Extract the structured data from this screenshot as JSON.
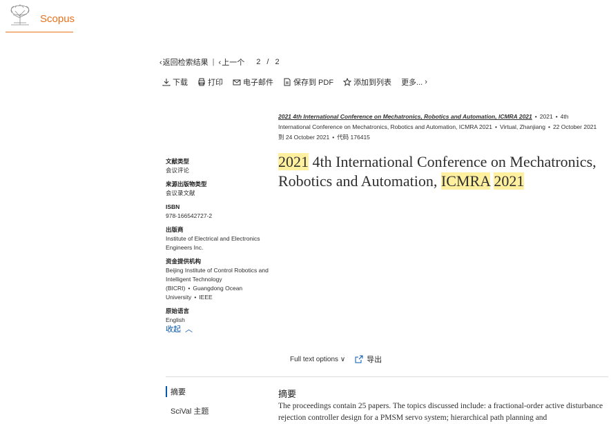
{
  "brand": {
    "name": "Scopus",
    "color": "#e9711c",
    "logo_icon": "elsevier-tree-icon"
  },
  "nav": {
    "back": "返回检索结果",
    "prev": "上一个",
    "page_current": "2",
    "page_sep": "/",
    "page_total": "2"
  },
  "toolbar": {
    "download": "下载",
    "print": "打印",
    "email": "电子邮件",
    "save_pdf": "保存到 PDF",
    "add_list": "添加到列表",
    "more": "更多..."
  },
  "source": {
    "title": "2021 4th International Conference on Mechatronics, Robotics and Automation, ICMRA 2021",
    "year": "2021",
    "line2_a": "4th",
    "line2_b": "International Conference on Mechatronics, Robotics and Automation, ICMRA 2021",
    "location": "Virtual, Zhanjiang",
    "dates_a": "22 October 2021",
    "dates_b": "到 24 October 2021",
    "code": "代码 176415"
  },
  "meta": {
    "doc_type_label": "文献类型",
    "doc_type": "会议评论",
    "source_type_label": "来源出版物类型",
    "source_type": "会议录文献",
    "isbn_label": "ISBN",
    "isbn": "978-166542727-2",
    "publisher_label": "出版商",
    "publisher": "Institute of Electrical and Electronics Engineers Inc.",
    "funding_label": "资金提供机构",
    "funding_1": "Beijing Institute of Control Robotics and Intelligent Technology (BICRI)",
    "funding_2": "Guangdong Ocean University",
    "funding_3": "IEEE",
    "language_label": "原始语言",
    "language": "English",
    "collapse": "收起"
  },
  "title": {
    "part1": "2021",
    "part2": " 4th International Conference on Mechatronics, Robotics and Automation, ",
    "part3": "ICMRA",
    "part4": " ",
    "part5": "2021"
  },
  "fulltext": {
    "options": "Full text options",
    "export": "导出"
  },
  "sections": {
    "abstract": "摘要",
    "scival": "SciVal 主题"
  },
  "abstract": {
    "heading": "摘要",
    "text": "The proceedings contain 25 papers. The topics discussed include: a fractional-order active disturbance rejection controller design for a PMSM servo system; hierarchical path planning and"
  },
  "colors": {
    "accent": "#0656ad",
    "highlight": "#fff0a0"
  }
}
